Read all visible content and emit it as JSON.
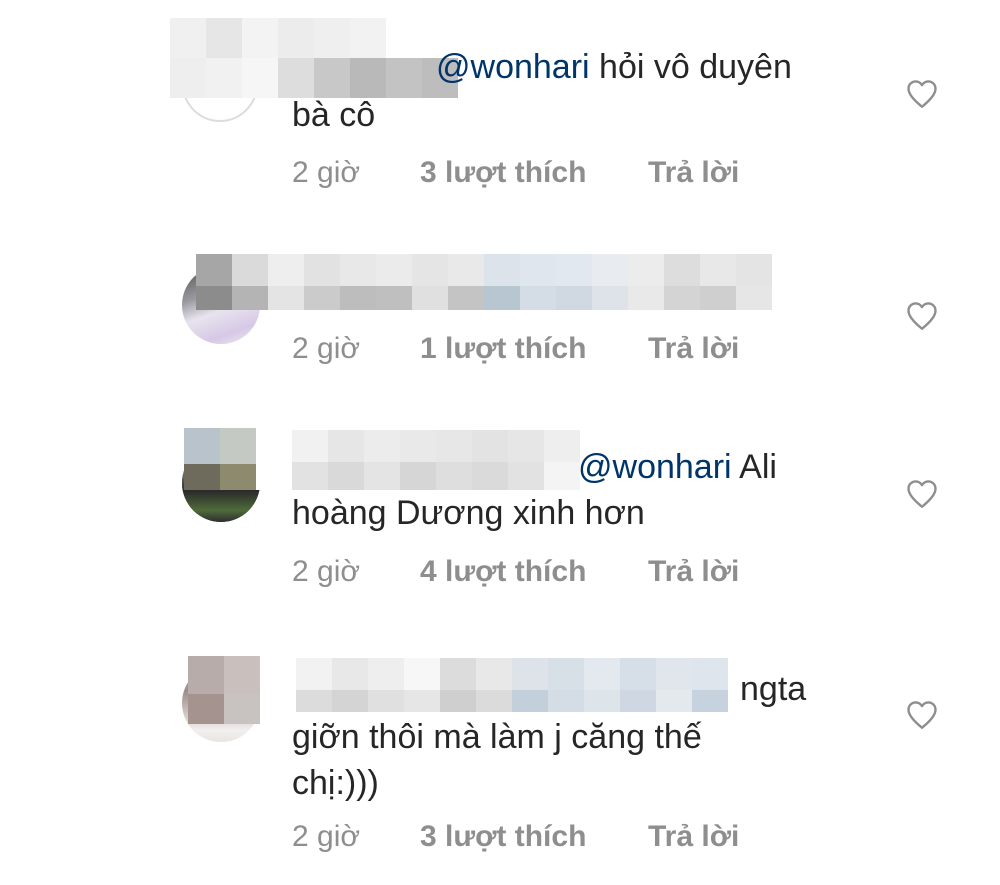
{
  "colors": {
    "background": "#ffffff",
    "text": "#262626",
    "mention": "#003569",
    "meta": "#8e8e8e",
    "heart_stroke": "#8e8e8e"
  },
  "icons": {
    "like": "heart-outline-icon"
  },
  "comments": [
    {
      "mention": "@wonhari",
      "text_line1": " hỏi vô duyên",
      "text_line2": "bà cô",
      "time": "2 giờ",
      "likes": "3 lượt thích",
      "reply": "Trả lời"
    },
    {
      "mention": "",
      "text_line1": "",
      "text_line2": "",
      "time": "2 giờ",
      "likes": "1 lượt thích",
      "reply": "Trả lời"
    },
    {
      "mention": "@wonhari",
      "text_line1": " Ali",
      "text_line2": "hoàng Dương xinh hơn",
      "time": "2 giờ",
      "likes": "4 lượt thích",
      "reply": "Trả lời"
    },
    {
      "mention": "",
      "text_line1": "ngta",
      "text_line2": "giỡn thôi mà làm j căng thế",
      "text_line3": "chị:)))",
      "time": "2 giờ",
      "likes": "3 lượt thích",
      "reply": "Trả lời"
    }
  ]
}
